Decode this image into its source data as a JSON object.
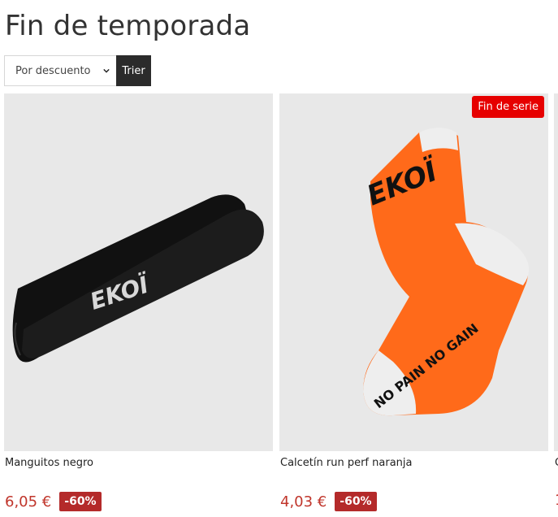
{
  "page": {
    "title": "Fin de temporada"
  },
  "sort": {
    "selected": "Por descuento",
    "button_label": "Trier"
  },
  "products": [
    {
      "name": "Manguitos negro",
      "price": "6,05 €",
      "discount": "-60%",
      "brand_mark": "EKOÏ",
      "image": "black-arm-sleeves",
      "badge": null
    },
    {
      "name": "Calcetín run perf naranja",
      "price": "4,03 €",
      "discount": "-60%",
      "brand_mark": "EKOÏ",
      "sole_text": "NO PAIN NO GAIN",
      "image": "orange-sock",
      "badge": "Fin de serie"
    },
    {
      "name": "C",
      "price": "1",
      "image": "partial-product"
    }
  ],
  "colors": {
    "price": "#c0352b",
    "discount_bg": "#b42a2a",
    "badge_bg": "#e60000",
    "sort_button_bg": "#2b2b2b"
  }
}
